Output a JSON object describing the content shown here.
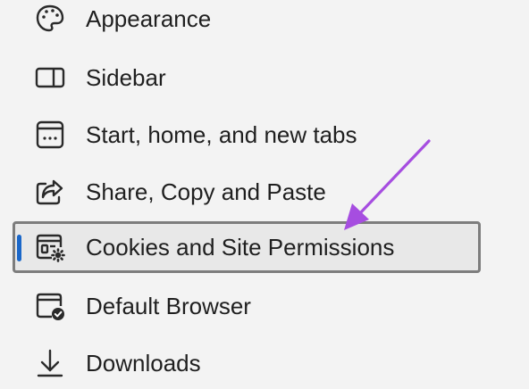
{
  "nav": {
    "items": [
      {
        "label": "Appearance",
        "icon": "palette-icon"
      },
      {
        "label": "Sidebar",
        "icon": "sidebar-icon"
      },
      {
        "label": "Start, home, and new tabs",
        "icon": "start-page-icon"
      },
      {
        "label": "Share, Copy and Paste",
        "icon": "share-icon"
      },
      {
        "label": "Cookies and Site Permissions",
        "icon": "cookies-permissions-icon",
        "selected": true
      },
      {
        "label": "Default Browser",
        "icon": "default-browser-icon"
      },
      {
        "label": "Downloads",
        "icon": "download-icon"
      }
    ]
  },
  "colors": {
    "selected_indicator": "#1a67c9",
    "selected_outline": "#7d7d7d",
    "arrow": "#a64de0",
    "background": "#f3f3f3"
  }
}
